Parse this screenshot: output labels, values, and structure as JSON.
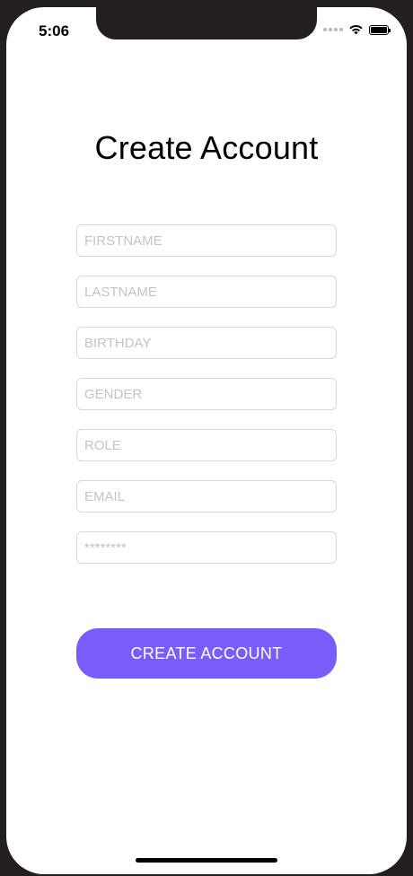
{
  "status_bar": {
    "time": "5:06",
    "icons": [
      "signal-dots-icon",
      "wifi-icon",
      "battery-icon"
    ]
  },
  "page": {
    "title": "Create Account"
  },
  "form": {
    "fields": [
      {
        "name": "firstname",
        "placeholder": "FIRSTNAME",
        "value": ""
      },
      {
        "name": "lastname",
        "placeholder": "LASTNAME",
        "value": ""
      },
      {
        "name": "birthday",
        "placeholder": "BIRTHDAY",
        "value": ""
      },
      {
        "name": "gender",
        "placeholder": "GENDER",
        "value": ""
      },
      {
        "name": "role",
        "placeholder": "ROLE",
        "value": ""
      },
      {
        "name": "email",
        "placeholder": "EMAIL",
        "value": ""
      },
      {
        "name": "password",
        "placeholder": "********",
        "value": ""
      }
    ],
    "submit_label": "CREATE ACCOUNT"
  },
  "colors": {
    "accent": "#7a5cfa",
    "field_border": "#d9d9d9",
    "placeholder": "#c4c4c4",
    "frame": "#231f20"
  }
}
